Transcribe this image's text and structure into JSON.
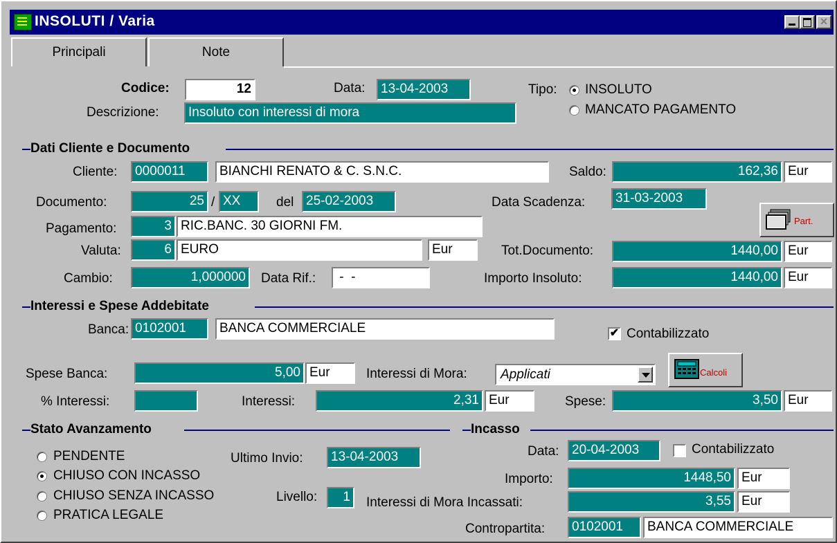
{
  "window": {
    "title": "INSOLUTI / Varia",
    "close_glyph": "×"
  },
  "tabs": [
    {
      "label": "Principali"
    },
    {
      "label": "Note"
    }
  ],
  "header": {
    "codice_label": "Codice:",
    "codice": "12",
    "data_label": "Data:",
    "data": "13-04-2003",
    "descrizione_label": "Descrizione:",
    "descrizione": "Insoluto con interessi di mora",
    "tipo_label": "Tipo:",
    "tipo_options": [
      "INSOLUTO",
      "MANCATO PAGAMENTO"
    ],
    "tipo_selected": "INSOLUTO"
  },
  "cliente_section": {
    "title": "Dati Cliente e Documento",
    "cliente_label": "Cliente:",
    "cliente_code": "0000011",
    "cliente_name": "BIANCHI RENATO & C. S.N.C.",
    "saldo_label": "Saldo:",
    "saldo": "162,36",
    "saldo_cur": "Eur",
    "documento_label": "Documento:",
    "documento_num": "25",
    "documento_sep": "/",
    "documento_serie": "XX",
    "del_label": "del",
    "documento_data": "25-02-2003",
    "scadenza_label": "Data Scadenza:",
    "scadenza": "31-03-2003",
    "part_label": "Part.",
    "pagamento_label": "Pagamento:",
    "pagamento_code": "3",
    "pagamento_desc": "RIC.BANC. 30 GIORNI FM.",
    "valuta_label": "Valuta:",
    "valuta_code": "6",
    "valuta_desc": "EURO",
    "valuta_sym": "Eur",
    "totdoc_label": "Tot.Documento:",
    "totdoc": "1440,00",
    "totdoc_cur": "Eur",
    "cambio_label": "Cambio:",
    "cambio": "1,000000",
    "datarif_label": "Data Rif.:",
    "datarif": " -  - ",
    "importo_label": "Importo Insoluto:",
    "importo": "1440,00",
    "importo_cur": "Eur"
  },
  "interessi_section": {
    "title": "Interessi e Spese Addebitate",
    "banca_label": "Banca:",
    "banca_code": "0102001",
    "banca_name": "BANCA COMMERCIALE",
    "contabilizzato_label": "Contabilizzato",
    "contabilizzato_checked": true,
    "check_glyph": "✔",
    "spese_banca_label": "Spese Banca:",
    "spese_banca": "5,00",
    "spese_banca_cur": "Eur",
    "mora_label": "Interessi di Mora:",
    "mora_value": "Applicati",
    "calcoli_label": "Calcoli",
    "perc_label": "% Interessi:",
    "perc": "",
    "interessi_label": "Interessi:",
    "interessi": "2,31",
    "interessi_cur": "Eur",
    "spese_label": "Spese:",
    "spese": "3,50",
    "spese_cur": "Eur"
  },
  "stato_section": {
    "title": "Stato Avanzamento",
    "options": [
      "PENDENTE",
      "CHIUSO CON INCASSO",
      "CHIUSO SENZA INCASSO",
      "PRATICA LEGALE"
    ],
    "selected": "CHIUSO CON INCASSO",
    "ultimo_label": "Ultimo Invio:",
    "ultimo": "13-04-2003",
    "livello_label": "Livello:",
    "livello": "1"
  },
  "incasso_section": {
    "title": "Incasso",
    "data_label": "Data:",
    "data": "20-04-2003",
    "contabilizzato_label": "Contabilizzato",
    "contabilizzato_checked": false,
    "importo_label": "Importo:",
    "importo": "1448,50",
    "importo_cur": "Eur",
    "mora_label": "Interessi di Mora Incassati:",
    "mora": "3,55",
    "mora_cur": "Eur",
    "contro_label": "Contropartita:",
    "contro_code": "0102001",
    "contro_name": "BANCA COMMERCIALE"
  },
  "colors": {
    "field_teal": "#008080",
    "title_bar": "#000080",
    "window_bg": "#c0c0c0"
  }
}
